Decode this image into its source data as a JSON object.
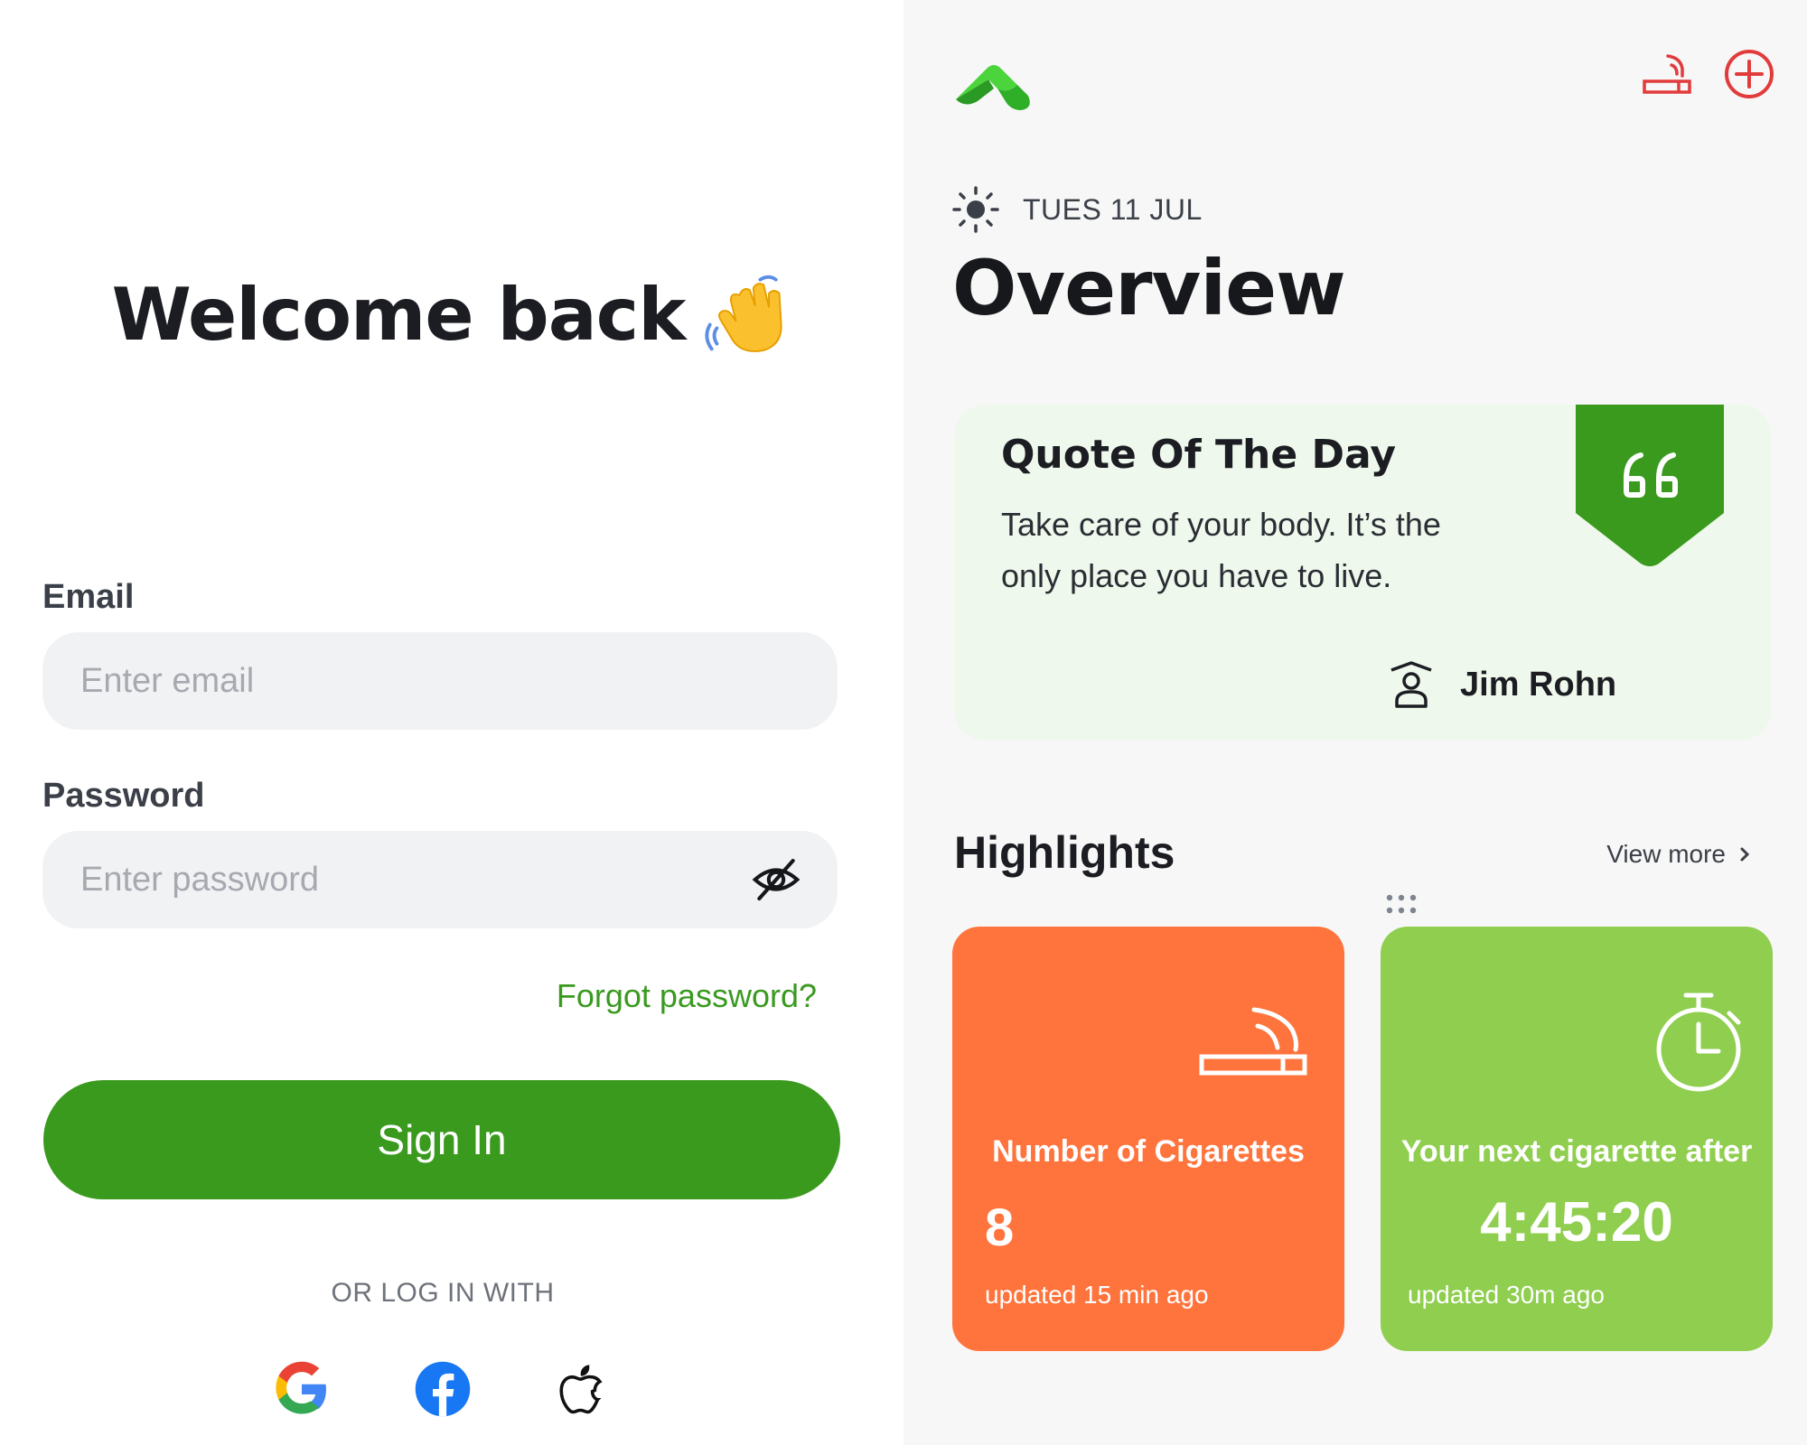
{
  "login": {
    "welcome_title": "Welcome back",
    "email": {
      "label": "Email",
      "placeholder": "Enter email",
      "value": ""
    },
    "password": {
      "label": "Password",
      "placeholder": "Enter password",
      "value": ""
    },
    "forgot_label": "Forgot password?",
    "signin_label": "Sign In",
    "or_label": "OR LOG IN WITH",
    "social": [
      "google-icon",
      "facebook-icon",
      "apple-icon"
    ]
  },
  "overview": {
    "date": "TUES  11 JUL",
    "title": "Overview",
    "quote": {
      "heading": "Quote Of The Day",
      "text": "Take care of your body. It’s the only place you have to live.",
      "author": "Jim Rohn"
    },
    "highlights": {
      "title": "Highlights",
      "view_more": "View more",
      "cards": [
        {
          "title": "Number of Cigarettes",
          "value": "8",
          "updated": "updated 15 min ago"
        },
        {
          "title": "Your next cigarette after",
          "value": "4:45:20",
          "updated": "updated 30m ago"
        }
      ]
    }
  },
  "colors": {
    "primary_green": "#3a9a1e",
    "link_green": "#3a9a20",
    "danger_red": "#e23b3b",
    "card_orange": "#ff743d",
    "card_green": "#8fce4e",
    "quote_bg": "#eff8ec"
  }
}
